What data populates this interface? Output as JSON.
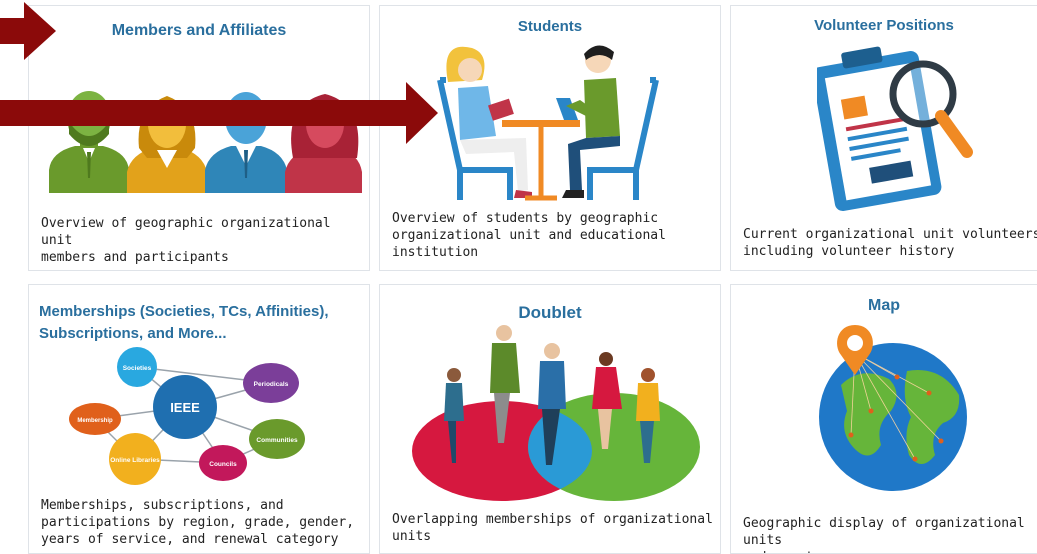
{
  "cards": [
    {
      "title": "Members and Affiliates",
      "description": "Overview of geographic organizational unit\nmembers and participants",
      "image": "members-illustration"
    },
    {
      "title": "Students",
      "description": "Overview of students by geographic\norganizational unit and educational\ninstitution",
      "image": "students-illustration"
    },
    {
      "title": "Volunteer Positions",
      "description": "Current organizational unit volunteers\nincluding volunteer history",
      "image": "clipboard-magnifier-illustration"
    },
    {
      "title": "Memberships (Societies, TCs, Affinities),\nSubscriptions, and More...",
      "description": "Memberships, subscriptions, and\nparticipations by region, grade, gender,\nyears of service, and renewal category",
      "image": "ieee-network-diagram",
      "diagram": {
        "center": "IEEE",
        "nodes": [
          "Societies",
          "Periodicals",
          "Communities",
          "Councils",
          "Online Libraries",
          "Membership"
        ]
      }
    },
    {
      "title": "Doublet",
      "description": "Overlapping memberships of organizational\nunits",
      "image": "venn-people-illustration"
    },
    {
      "title": "Map",
      "description": "Geographic display of organizational units\nand counts",
      "image": "globe-pin-illustration"
    }
  ],
  "colors": {
    "title": "#2a6f9e",
    "arrow": "#8b0a0a"
  }
}
